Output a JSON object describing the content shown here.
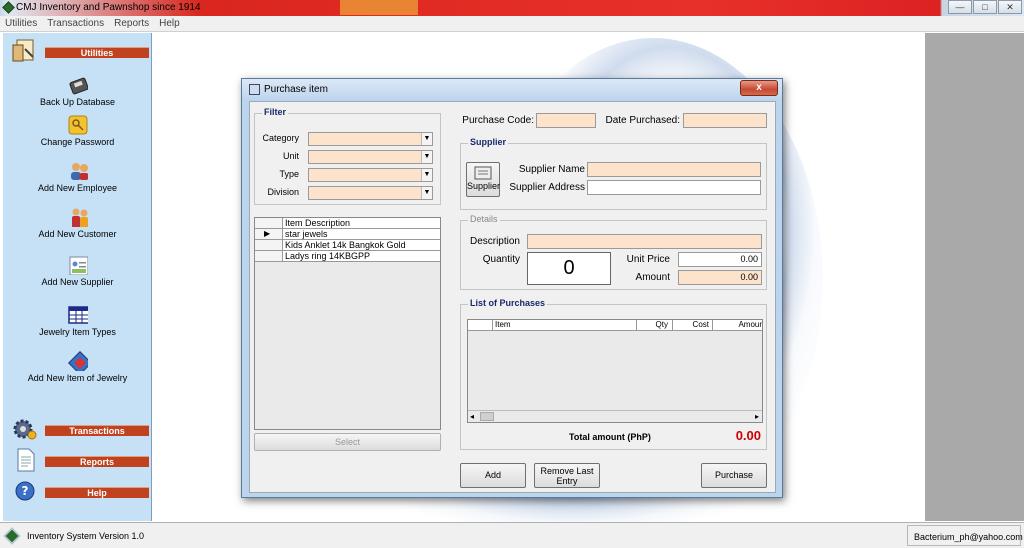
{
  "window": {
    "title": "CMJ Inventory and Pawnshop since 1914",
    "controls": {
      "minimize": "—",
      "maximize": "□",
      "close": "✕"
    }
  },
  "menu": [
    "Utilities",
    "Transactions",
    "Reports",
    "Help"
  ],
  "sidebar": {
    "utilities_header": "Utilities",
    "items": [
      {
        "label": "Back Up Database",
        "icon": "database-icon"
      },
      {
        "label": "Change Password",
        "icon": "key-icon"
      },
      {
        "label": "Add New Employee",
        "icon": "users-icon"
      },
      {
        "label": "Add New Customer",
        "icon": "customer-icon"
      },
      {
        "label": "Add New Supplier",
        "icon": "contact-card-icon"
      },
      {
        "label": "Jewelry Item Types",
        "icon": "table-icon"
      },
      {
        "label": "Add New Item of Jewelry",
        "icon": "item-icon"
      }
    ],
    "transactions_header": "Transactions",
    "reports_header": "Reports",
    "help_header": "Help"
  },
  "dialog": {
    "title": "Purchase item",
    "close": "x",
    "filter": {
      "legend": "Filter",
      "category_label": "Category",
      "unit_label": "Unit",
      "type_label": "Type",
      "division_label": "Division"
    },
    "items_grid": {
      "header": "Item Description",
      "rows": [
        "star jewels",
        "Kids Anklet 14k Bangkok Gold",
        "Ladys ring 14KBGPP"
      ],
      "selected_marker": "▶"
    },
    "select_button": "Select",
    "purchase_code_label": "Purchase Code:",
    "purchase_code_value": "",
    "date_purchased_label": "Date Purchased:",
    "date_purchased_value": "",
    "supplier": {
      "legend": "Supplier",
      "button": "Supplier",
      "name_label": "Supplier Name",
      "address_label": "Supplier Address"
    },
    "details": {
      "legend": "Details",
      "description_label": "Description",
      "quantity_label": "Quantity",
      "quantity_value": "0",
      "unit_price_label": "Unit Price",
      "unit_price_value": "0.00",
      "amount_label": "Amount",
      "amount_value": "0.00"
    },
    "list_of_purchases": {
      "legend": "List of Purchases",
      "columns": [
        "Item",
        "Qty",
        "Cost",
        "Amour"
      ],
      "scroll_left": "◂",
      "scroll_right": "▸"
    },
    "total_label": "Total amount (PhP)",
    "total_value": "0.00",
    "buttons": {
      "add": "Add",
      "remove_last": "Remove Last Entry",
      "purchase": "Purchase"
    }
  },
  "statusbar": {
    "version": "Inventory System Version 1.0",
    "email": "Bacterium_ph@yahoo.com"
  },
  "colors": {
    "accent_red": "#c0421f",
    "total_red": "#cc0000",
    "field_peach": "#fde3cc",
    "sidebar_blue": "#c6e1f6"
  }
}
